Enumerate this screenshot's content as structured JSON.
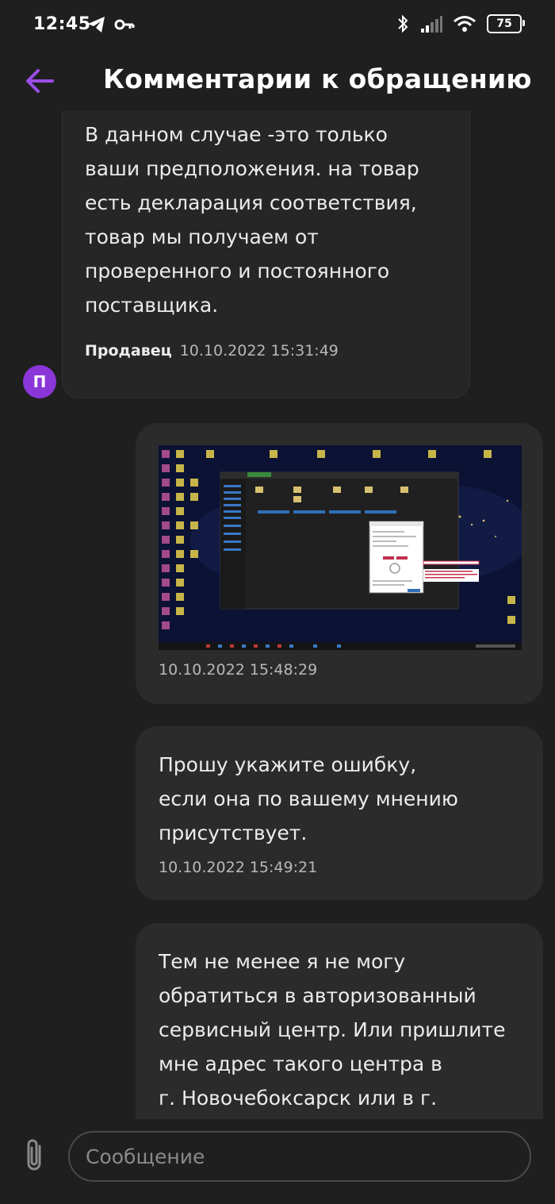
{
  "status_bar": {
    "time": "12:45",
    "left_icons": [
      "telegram-icon",
      "key-icon"
    ],
    "right_icons": [
      "bluetooth-icon",
      "signal-icon",
      "wifi-icon"
    ],
    "battery": "75"
  },
  "header": {
    "title": "Комментарии к обращению",
    "back_icon": "arrow-left-icon",
    "accent_color": "#9b4de8"
  },
  "messages": [
    {
      "direction": "incoming",
      "text": "В данном случае -это только\nваши предположения. на товар\nесть декларация соответствия,\nтовар мы получаем от\nпроверенного и постоянного\nпоставщика.",
      "sender": "Продавец",
      "time": "10.10.2022 15:31:49",
      "avatar_letter": "П",
      "avatar_color": "#8a36d8"
    },
    {
      "direction": "outgoing",
      "attachment": "screenshot-image",
      "time": "10.10.2022 15:48:29"
    },
    {
      "direction": "outgoing",
      "text": "Прошу укажите ошибку,\nесли она по вашему мнению\nприсутствует.",
      "time": "10.10.2022 15:49:21"
    },
    {
      "direction": "outgoing",
      "text": "Тем не менее я не могу\nобратиться в авторизованный\nсервисный центр. Или пришлите\nмне адрес такого центра в\nг. Новочебоксарск или в г."
    }
  ],
  "composer": {
    "placeholder": "Сообщение",
    "attach_icon": "paperclip-icon"
  }
}
